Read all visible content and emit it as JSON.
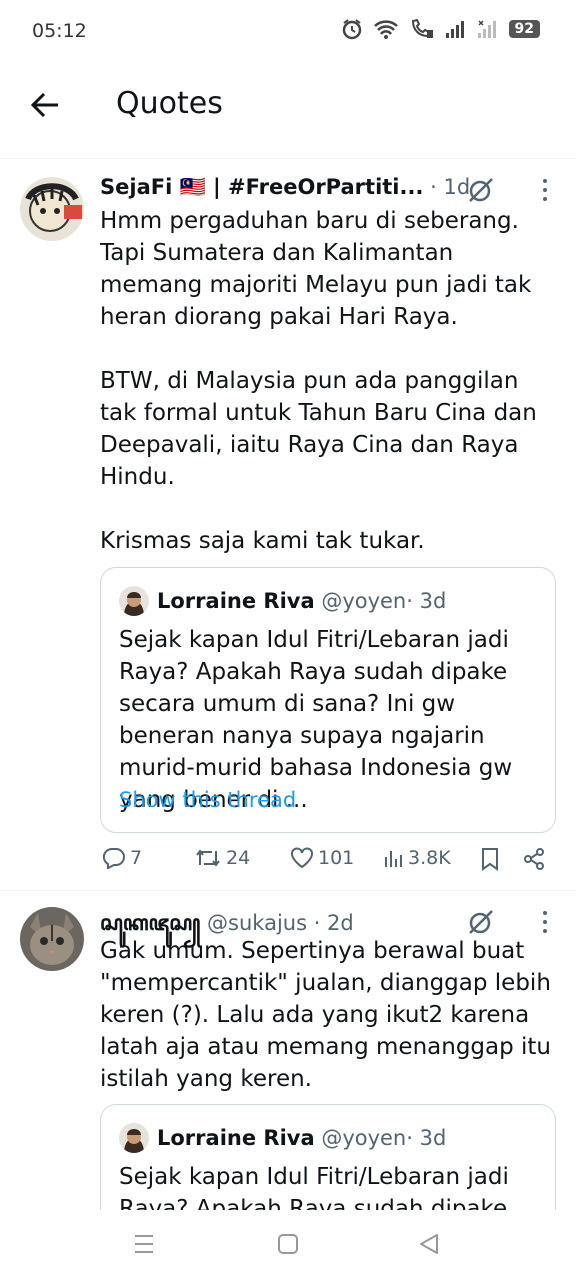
{
  "status": {
    "time": "05:12",
    "battery": "92"
  },
  "header": {
    "title": "Quotes"
  },
  "tweets": [
    {
      "name": "SejaFi 🇲🇾 | #FreeOrPartiti...",
      "time": " · 1d",
      "paragraphs": [
        "Hmm pergaduhan baru di seberang. Tapi Sumatera dan Kalimantan memang majoriti Melayu pun jadi tak heran diorang pakai Hari Raya.",
        "BTW, di Malaysia pun ada panggilan tak formal untuk Tahun Baru Cina dan Deepavali, iaitu Raya Cina dan Raya Hindu.",
        "Krismas saja kami tak tukar."
      ],
      "quote": {
        "name": "Lorraine Riva",
        "handle": "@yoyen",
        "time": " · 3d",
        "text": "Sejak kapan Idul Fitri/Lebaran jadi Raya? Apakah Raya sudah dipake secara umum di sana? Ini gw beneran nanya supaya ngajarin murid-murid bahasa Indonesia gw yang bener di ...",
        "show_thread": "Show this thread"
      },
      "actions": {
        "replies": "7",
        "retweets": "24",
        "likes": "101",
        "views": "3.8K"
      }
    },
    {
      "name": "ꦱꦸꦏꦗꦸꦱ꧀",
      "handle": " @sukajus",
      "time": " · 2d",
      "paragraphs": [
        "Gak umum. Sepertinya berawal buat \"mempercantik\" jualan, dianggap lebih keren (?). Lalu ada yang ikut2 karena latah aja atau memang menanggap itu istilah yang keren."
      ],
      "quote": {
        "name": "Lorraine Riva",
        "handle": "@yoyen",
        "time": " · 3d",
        "text": "Sejak kapan Idul Fitri/Lebaran jadi Raya? Apakah Raya sudah dipake"
      }
    }
  ],
  "colors": {
    "link": "#1d9bf0",
    "muted": "#536471",
    "border": "#cfd9de"
  }
}
